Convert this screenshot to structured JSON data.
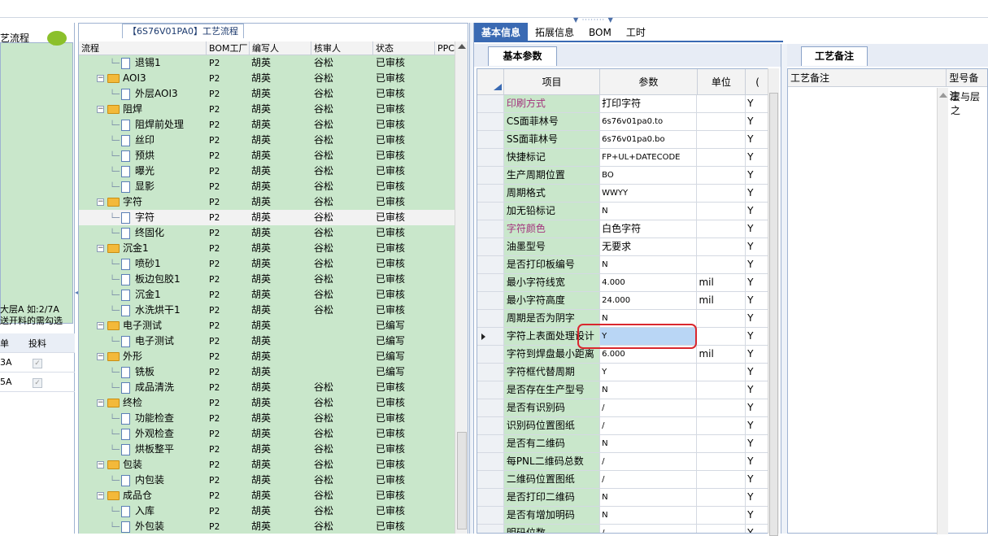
{
  "window": {
    "title_tab": "【6S76V01PA0】工艺流程"
  },
  "left": {
    "title": "艺流程",
    "note_line1": "大层A 如:2/7A",
    "note_line2": "送开料的需勾选",
    "grid_headers": [
      "单",
      "投料"
    ],
    "grid_rows": [
      "3A",
      "5A"
    ]
  },
  "tree": {
    "columns": [
      "流程",
      "BOM工厂",
      "编写人",
      "核审人",
      "状态",
      "PPC"
    ],
    "rows": [
      {
        "type": "child",
        "name": "退锡1",
        "bom": "P2",
        "writer": "胡英",
        "reviewer": "谷松",
        "status": "已审核"
      },
      {
        "type": "folder",
        "name": "AOI3",
        "bom": "P2",
        "writer": "胡英",
        "reviewer": "谷松",
        "status": "已审核"
      },
      {
        "type": "child",
        "name": "外层AOI3",
        "bom": "P2",
        "writer": "胡英",
        "reviewer": "谷松",
        "status": "已审核"
      },
      {
        "type": "folder",
        "name": "阻焊",
        "bom": "P2",
        "writer": "胡英",
        "reviewer": "谷松",
        "status": "已审核"
      },
      {
        "type": "child",
        "name": "阻焊前处理",
        "bom": "P2",
        "writer": "胡英",
        "reviewer": "谷松",
        "status": "已审核"
      },
      {
        "type": "child",
        "name": "丝印",
        "bom": "P2",
        "writer": "胡英",
        "reviewer": "谷松",
        "status": "已审核"
      },
      {
        "type": "child",
        "name": "预烘",
        "bom": "P2",
        "writer": "胡英",
        "reviewer": "谷松",
        "status": "已审核"
      },
      {
        "type": "child",
        "name": "曝光",
        "bom": "P2",
        "writer": "胡英",
        "reviewer": "谷松",
        "status": "已审核"
      },
      {
        "type": "child",
        "name": "显影",
        "bom": "P2",
        "writer": "胡英",
        "reviewer": "谷松",
        "status": "已审核"
      },
      {
        "type": "folder",
        "name": "字符",
        "bom": "P2",
        "writer": "胡英",
        "reviewer": "谷松",
        "status": "已审核"
      },
      {
        "type": "child",
        "name": "字符",
        "bom": "P2",
        "writer": "胡英",
        "reviewer": "谷松",
        "status": "已审核",
        "selected": true
      },
      {
        "type": "child",
        "name": "终固化",
        "bom": "P2",
        "writer": "胡英",
        "reviewer": "谷松",
        "status": "已审核"
      },
      {
        "type": "folder",
        "name": "沉金1",
        "bom": "P2",
        "writer": "胡英",
        "reviewer": "谷松",
        "status": "已审核"
      },
      {
        "type": "child",
        "name": "喷砂1",
        "bom": "P2",
        "writer": "胡英",
        "reviewer": "谷松",
        "status": "已审核"
      },
      {
        "type": "child",
        "name": "板边包胶1",
        "bom": "P2",
        "writer": "胡英",
        "reviewer": "谷松",
        "status": "已审核"
      },
      {
        "type": "child",
        "name": "沉金1",
        "bom": "P2",
        "writer": "胡英",
        "reviewer": "谷松",
        "status": "已审核"
      },
      {
        "type": "child",
        "name": "水洗烘干1",
        "bom": "P2",
        "writer": "胡英",
        "reviewer": "谷松",
        "status": "已审核"
      },
      {
        "type": "folder",
        "name": "电子测试",
        "bom": "P2",
        "writer": "胡英",
        "reviewer": "",
        "status": "已编写"
      },
      {
        "type": "child",
        "name": "电子测试",
        "bom": "P2",
        "writer": "胡英",
        "reviewer": "",
        "status": "已编写"
      },
      {
        "type": "folder",
        "name": "外形",
        "bom": "P2",
        "writer": "胡英",
        "reviewer": "",
        "status": "已编写"
      },
      {
        "type": "child",
        "name": "铣板",
        "bom": "P2",
        "writer": "胡英",
        "reviewer": "",
        "status": "已编写"
      },
      {
        "type": "child",
        "name": "成品清洗",
        "bom": "P2",
        "writer": "胡英",
        "reviewer": "谷松",
        "status": "已审核"
      },
      {
        "type": "folder",
        "name": "终检",
        "bom": "P2",
        "writer": "胡英",
        "reviewer": "谷松",
        "status": "已审核"
      },
      {
        "type": "child",
        "name": "功能检查",
        "bom": "P2",
        "writer": "胡英",
        "reviewer": "谷松",
        "status": "已审核"
      },
      {
        "type": "child",
        "name": "外观检查",
        "bom": "P2",
        "writer": "胡英",
        "reviewer": "谷松",
        "status": "已审核"
      },
      {
        "type": "child",
        "name": "烘板整平",
        "bom": "P2",
        "writer": "胡英",
        "reviewer": "谷松",
        "status": "已审核"
      },
      {
        "type": "folder",
        "name": "包装",
        "bom": "P2",
        "writer": "胡英",
        "reviewer": "谷松",
        "status": "已审核"
      },
      {
        "type": "child",
        "name": "内包装",
        "bom": "P2",
        "writer": "胡英",
        "reviewer": "谷松",
        "status": "已审核"
      },
      {
        "type": "folder",
        "name": "成品仓",
        "bom": "P2",
        "writer": "胡英",
        "reviewer": "谷松",
        "status": "已审核"
      },
      {
        "type": "child",
        "name": "入库",
        "bom": "P2",
        "writer": "胡英",
        "reviewer": "谷松",
        "status": "已审核"
      },
      {
        "type": "child",
        "name": "外包装",
        "bom": "P2",
        "writer": "胡英",
        "reviewer": "谷松",
        "status": "已审核"
      }
    ]
  },
  "mid": {
    "tabs": [
      "基本信息",
      "拓展信息",
      "BOM",
      "工时"
    ],
    "subtab": "基本参数",
    "columns": [
      "项目",
      "参数",
      "单位",
      "("
    ],
    "rows": [
      {
        "item": "印刷方式",
        "value": "打印字符",
        "unit": "",
        "flag": "Y",
        "pink": true
      },
      {
        "item": "CS面菲林号",
        "value": "6s76v01pa0.to",
        "unit": "",
        "flag": "Y"
      },
      {
        "item": "SS面菲林号",
        "value": "6s76v01pa0.bo",
        "unit": "",
        "flag": "Y"
      },
      {
        "item": "快捷标记",
        "value": "FP+UL+DATECODE",
        "unit": "",
        "flag": "Y"
      },
      {
        "item": "生产周期位置",
        "value": "BO",
        "unit": "",
        "flag": "Y"
      },
      {
        "item": "周期格式",
        "value": "WWYY",
        "unit": "",
        "flag": "Y"
      },
      {
        "item": "加无铅标记",
        "value": "N",
        "unit": "",
        "flag": "Y"
      },
      {
        "item": "字符颜色",
        "value": "白色字符",
        "unit": "",
        "flag": "Y",
        "pink": true
      },
      {
        "item": "油墨型号",
        "value": "无要求",
        "unit": "",
        "flag": "Y"
      },
      {
        "item": "是否打印板编号",
        "value": "N",
        "unit": "",
        "flag": "Y"
      },
      {
        "item": "最小字符线宽",
        "value": "4.000",
        "unit": "mil",
        "flag": "Y"
      },
      {
        "item": "最小字符高度",
        "value": "24.000",
        "unit": "mil",
        "flag": "Y"
      },
      {
        "item": "周期是否为阴字",
        "value": "N",
        "unit": "",
        "flag": "Y"
      },
      {
        "item": "字符上表面处理设计",
        "value": "Y",
        "unit": "",
        "flag": "Y",
        "selected": true
      },
      {
        "item": "字符到焊盘最小距离",
        "value": "6.000",
        "unit": "mil",
        "flag": "Y"
      },
      {
        "item": "字符框代替周期",
        "value": "Y",
        "unit": "",
        "flag": "Y"
      },
      {
        "item": "是否存在生产型号",
        "value": "N",
        "unit": "",
        "flag": "Y"
      },
      {
        "item": "是否有识别码",
        "value": "/",
        "unit": "",
        "flag": "Y"
      },
      {
        "item": "识别码位置图纸",
        "value": "/",
        "unit": "",
        "flag": "Y"
      },
      {
        "item": "是否有二维码",
        "value": "N",
        "unit": "",
        "flag": "Y"
      },
      {
        "item": "每PNL二维码总数",
        "value": "/",
        "unit": "",
        "flag": "Y"
      },
      {
        "item": "二维码位置图纸",
        "value": "/",
        "unit": "",
        "flag": "Y"
      },
      {
        "item": "是否打印二维码",
        "value": "N",
        "unit": "",
        "flag": "Y"
      },
      {
        "item": "是否有增加明码",
        "value": "N",
        "unit": "",
        "flag": "Y"
      },
      {
        "item": "明码位数",
        "value": "/",
        "unit": "",
        "flag": "Y"
      }
    ]
  },
  "right": {
    "subtab": "工艺备注",
    "columns": [
      "工艺备注",
      "型号备注"
    ],
    "cell2": "层与层之"
  },
  "colors": {
    "accent": "#3a6ab3",
    "tree_bg": "#c9e7cb",
    "highlight_red": "#d9272e"
  }
}
